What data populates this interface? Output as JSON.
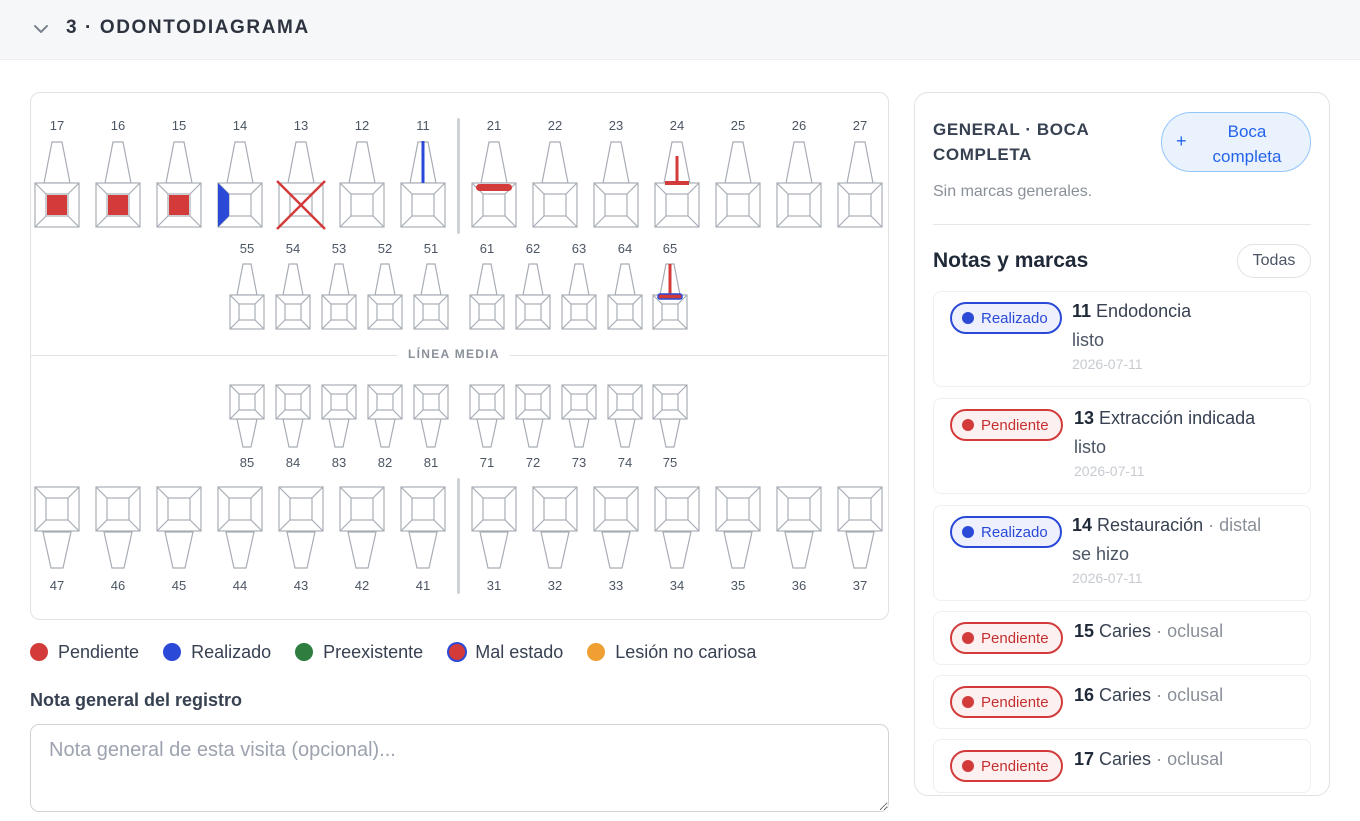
{
  "section": {
    "title": "3 · ODONTODIAGRAMA"
  },
  "chart": {
    "midline_label": "LÍNEA MEDIA",
    "upper_permanent": [
      "17",
      "16",
      "15",
      "14",
      "13",
      "12",
      "11",
      "21",
      "22",
      "23",
      "24",
      "25",
      "26",
      "27"
    ],
    "upper_primary": [
      "55",
      "54",
      "53",
      "52",
      "51",
      "61",
      "62",
      "63",
      "64",
      "65"
    ],
    "lower_primary": [
      "85",
      "84",
      "83",
      "82",
      "81",
      "71",
      "72",
      "73",
      "74",
      "75"
    ],
    "lower_permanent": [
      "47",
      "46",
      "45",
      "44",
      "43",
      "42",
      "41",
      "31",
      "32",
      "33",
      "34",
      "35",
      "36",
      "37"
    ],
    "marks": [
      {
        "tooth": "17",
        "kind": "occlusal",
        "color": "#d33b3b"
      },
      {
        "tooth": "16",
        "kind": "occlusal",
        "color": "#d33b3b"
      },
      {
        "tooth": "15",
        "kind": "occlusal",
        "color": "#d33b3b"
      },
      {
        "tooth": "14",
        "kind": "distal",
        "color": "#2a49d6"
      },
      {
        "tooth": "13",
        "kind": "extraction",
        "color": "#d33b3b"
      },
      {
        "tooth": "11",
        "kind": "root-canal",
        "color": "#2a49d6"
      },
      {
        "tooth": "21",
        "kind": "bridge-bar",
        "color": "#d33b3b"
      },
      {
        "tooth": "24",
        "kind": "post-crown",
        "color": "#d33b3b"
      },
      {
        "tooth": "65",
        "kind": "post-crown-bad",
        "color": "#d33b3b",
        "outline": "#2a49d6"
      }
    ]
  },
  "legend": [
    {
      "label": "Pendiente",
      "color": "#d33b3b"
    },
    {
      "label": "Realizado",
      "color": "#2a49d6"
    },
    {
      "label": "Preexistente",
      "color": "#2f7d3f"
    },
    {
      "label": "Mal estado",
      "color": "#d33b3b",
      "ring": "#2a49d6"
    },
    {
      "label": "Lesión no cariosa",
      "color": "#f0a032"
    }
  ],
  "note": {
    "label": "Nota general del registro",
    "placeholder": "Nota general de esta visita (opcional)..."
  },
  "sidebar": {
    "general_title": "GENERAL · BOCA COMPLETA",
    "boca_button": "Boca completa",
    "boca_plus": "+",
    "general_empty": "Sin marcas generales.",
    "notes_title": "Notas y marcas",
    "filter_button": "Todas",
    "items": [
      {
        "status": "Realizado",
        "tooth": "11",
        "treatment": "Endodoncia",
        "surface": "",
        "note": "listo",
        "date": "2026-07-11"
      },
      {
        "status": "Pendiente",
        "tooth": "13",
        "treatment": "Extracción indicada",
        "surface": "",
        "note": "listo",
        "date": "2026-07-11"
      },
      {
        "status": "Realizado",
        "tooth": "14",
        "treatment": "Restauración",
        "surface": "· distal",
        "note": "se hizo",
        "date": "2026-07-11"
      },
      {
        "status": "Pendiente",
        "tooth": "15",
        "treatment": "Caries",
        "surface": "· oclusal",
        "note": "",
        "date": ""
      },
      {
        "status": "Pendiente",
        "tooth": "16",
        "treatment": "Caries",
        "surface": "· oclusal",
        "note": "",
        "date": ""
      },
      {
        "status": "Pendiente",
        "tooth": "17",
        "treatment": "Caries",
        "surface": "· oclusal",
        "note": "",
        "date": ""
      }
    ]
  }
}
